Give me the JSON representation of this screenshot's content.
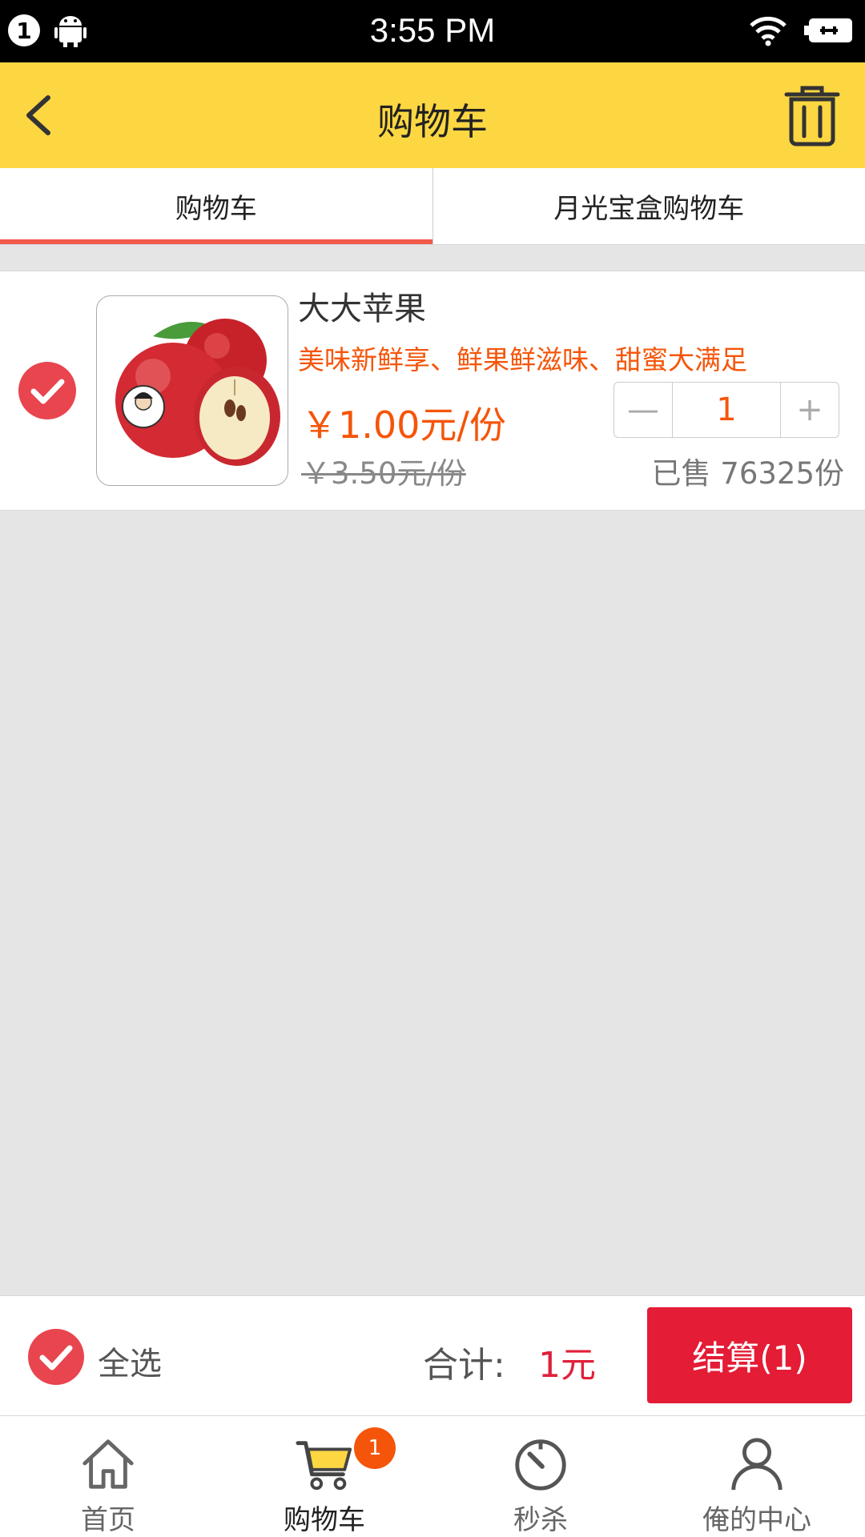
{
  "status_bar": {
    "notification_count": "1",
    "time": "3:55 PM"
  },
  "header": {
    "title": "购物车"
  },
  "tabs": [
    {
      "label": "购物车",
      "active": true
    },
    {
      "label": "月光宝盒购物车",
      "active": false
    }
  ],
  "cart_item": {
    "checked": true,
    "name": "大大苹果",
    "slogan": "美味新鲜享、鲜果鲜滋味、甜蜜大满足",
    "price": "￥1.00元/份",
    "original_price": "￥3.50元/份",
    "quantity": "1",
    "minus_label": "—",
    "plus_label": "+",
    "sold": "已售 76325份"
  },
  "checkout": {
    "select_all_label": "全选",
    "total_label": "合计:",
    "total_value": "1元",
    "pay_button": "结算(1)"
  },
  "bottom_nav": [
    {
      "label": "首页",
      "icon": "home-icon",
      "active": false
    },
    {
      "label": "购物车",
      "icon": "cart-icon",
      "active": true,
      "badge": "1"
    },
    {
      "label": "秒杀",
      "icon": "timer-icon",
      "active": false
    },
    {
      "label": "俺的中心",
      "icon": "user-icon",
      "active": false
    }
  ],
  "colors": {
    "header_bg": "#fcd742",
    "accent_orange": "#f5550a",
    "checkout_red": "#e41c36",
    "tab_indicator": "#f15a4a",
    "check_red": "#e8454f"
  }
}
